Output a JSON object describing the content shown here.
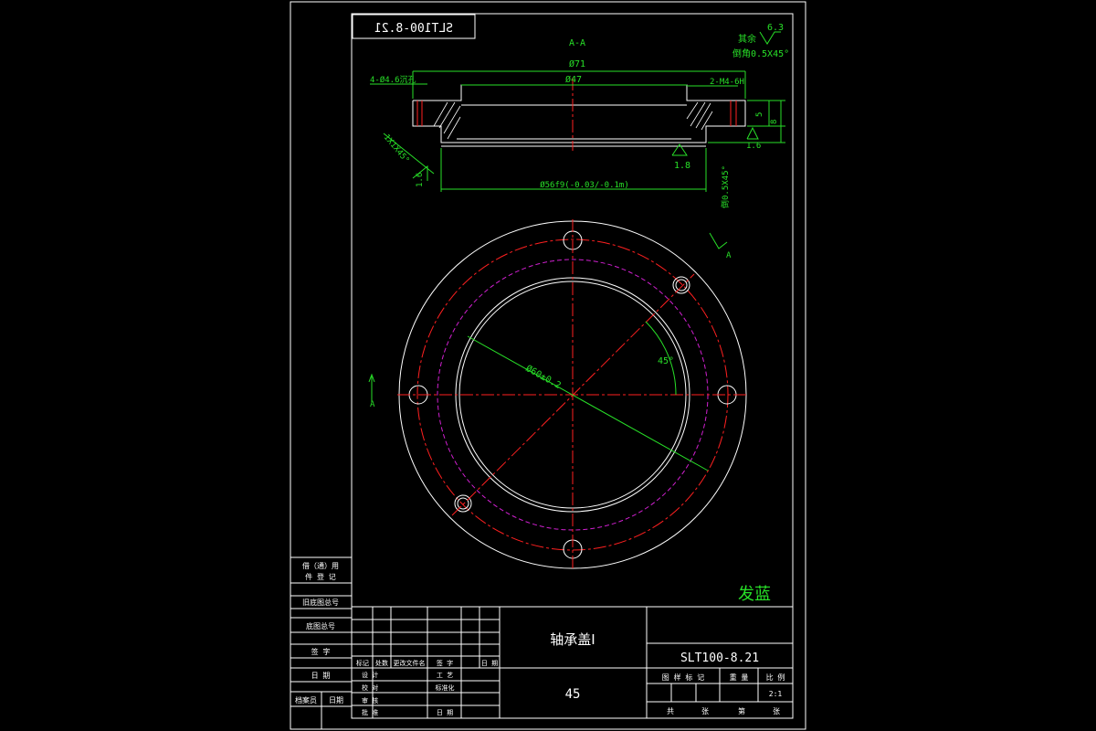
{
  "drawing": {
    "mirrored_code": "SLT100-8.21",
    "section_label": "A-A",
    "roughness_note": "其余",
    "roughness_value": "6.3",
    "chamfer_note": "倒角0.5X45°",
    "dims": {
      "d71": "Ø71",
      "d47": "Ø47",
      "holes_left": "4-Ø4.6沉孔",
      "holes_right": "2-M4-6H",
      "chamfer_left": "1X1X45°",
      "r16_left": "1.6",
      "r16_right": "1.6",
      "r18": "1.8",
      "d56": "Ø56f9(-0.03/-0.1m)",
      "side_note": "倒0.5X45°",
      "h5": "5",
      "h8": "8",
      "pcd": "Ø60±0.2",
      "angle": "45°",
      "arrow_a1": "A",
      "arrow_a2": "A"
    },
    "treatment": "发蓝"
  },
  "left_block": {
    "r1": "借（通）用",
    "r2": "件 登 记",
    "r3": "旧底图总号",
    "r4": "底图总号",
    "r5": "签 字",
    "r6": "日 期",
    "r7a": "档案员",
    "r7b": "日期"
  },
  "title_block": {
    "part_name": "轴承盖Ⅰ",
    "drawing_no": "SLT100-8.21",
    "material": "45",
    "scale_value": "2:1",
    "col_labels": [
      "标记",
      "处数",
      "更改文件名",
      "签 字",
      "日 期"
    ],
    "roles": [
      "设 计",
      "校 对",
      "审 核",
      "批 准"
    ],
    "process": "工 艺",
    "standard": "标准化",
    "date": "日 期",
    "attrs": [
      "图 样 标 记",
      "重 量",
      "比 例"
    ],
    "sheets": [
      "共",
      "张",
      "第",
      "张"
    ]
  }
}
